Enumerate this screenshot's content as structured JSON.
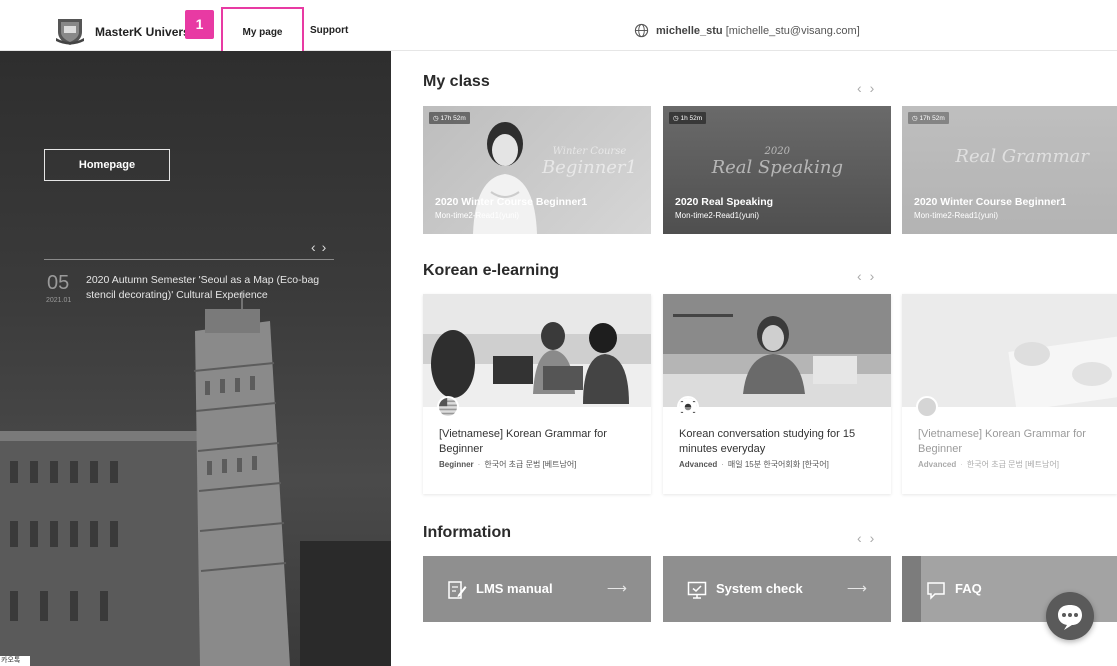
{
  "header": {
    "brand": "MasterK Univers",
    "step_badge": "1",
    "nav_mypage": "My page",
    "nav_support": "Support",
    "user_name": "michelle_stu",
    "user_email": "[michelle_stu@visang.com]"
  },
  "hero": {
    "homepage_button": "Homepage",
    "arrows": "‹›",
    "news": {
      "day": "05",
      "date": "2021.01",
      "text": "2020 Autumn Semester 'Seoul as a Map (Eco-bag stencil decorating)' Cultural Experience"
    },
    "footer_tag": "카오톡"
  },
  "my_class": {
    "title": "My class",
    "cards": [
      {
        "time": "17h 52m",
        "big_small": "Winter Course",
        "big": "Beginner1",
        "title": "2020 Winter Course Beginner1",
        "sub": "Mon-time2-Read1(yuni)"
      },
      {
        "time": "1h 52m",
        "big_small": "2020",
        "big": "Real Speaking",
        "title": "2020 Real Speaking",
        "sub": "Mon-time2-Read1(yuni)"
      },
      {
        "time": "17h 52m",
        "big_small": "",
        "big": "Real Grammar",
        "title": "2020 Winter Course Beginner1",
        "sub": "Mon-time2-Read1(yuni)"
      }
    ]
  },
  "elearning": {
    "title": "Korean e-learning",
    "cards": [
      {
        "title": "[Vietnamese] Korean Grammar for Beginner",
        "level": "Beginner",
        "korean": "한국어 초급 문법 [베트남어]"
      },
      {
        "title": "Korean conversation studying for 15 minutes everyday",
        "level": "Advanced",
        "korean": "매일 15분 한국어회화 [한국어]"
      },
      {
        "title": "[Vietnamese] Korean Grammar for Beginner",
        "level": "Advanced",
        "korean": "한국어 초급 문법 [베트남어]"
      }
    ]
  },
  "information": {
    "title": "Information",
    "cards": [
      {
        "label": "LMS manual",
        "icon": "edit-document-icon"
      },
      {
        "label": "System check",
        "icon": "monitor-check-icon"
      },
      {
        "label": "FAQ",
        "icon": "speech-bubble-icon"
      }
    ]
  },
  "colors": {
    "accent": "#e83aa3",
    "info_card": "#8f8f8f"
  }
}
